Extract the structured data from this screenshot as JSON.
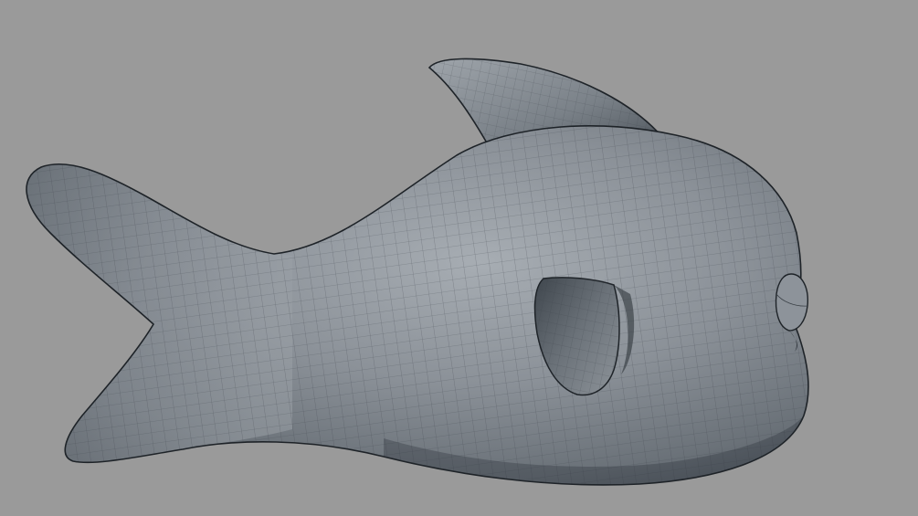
{
  "viewport": {
    "background_color": "#9a9a9a",
    "subject": "fish-mesh",
    "shading": "wireframe-on-shaded"
  },
  "colors": {
    "mesh_light": "#a4aab0",
    "mesh_mid": "#7e858c",
    "mesh_dark": "#4e555c",
    "mesh_shadow": "#2f353b",
    "wire": "#3a4046",
    "outline": "#1e2328"
  }
}
